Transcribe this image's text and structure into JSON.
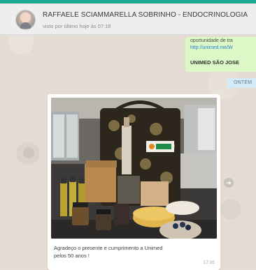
{
  "header": {
    "contact_name": "RAFFAELE SCIAMMARELLA SOBRINHO - ENDOCRINOLOGIA",
    "last_seen": "visto por último hoje às 07:18"
  },
  "previous_message": {
    "line1": "oportunidade de tra",
    "line2": "http://unimed.me/W",
    "line3": "UNIMED SÃO JOSE"
  },
  "date_label": "ONTEM",
  "image_message": {
    "caption_line1": "Agradeço o presente e cumprimento a Unimed",
    "caption_line2": "pelos 50 anos !",
    "time": "17:35"
  },
  "colors": {
    "accent": "#1ba98f",
    "outgoing_bubble": "#dcf8c6",
    "chat_bg": "#e4dcd2"
  }
}
